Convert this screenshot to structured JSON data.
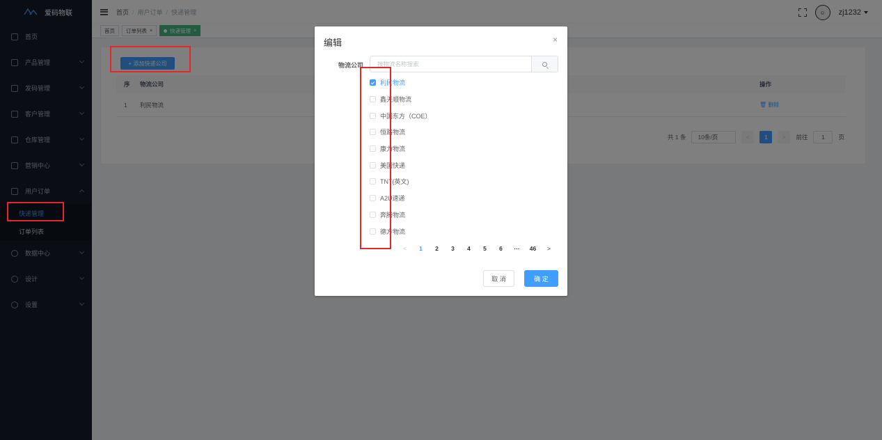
{
  "app": {
    "name": "爱码物联"
  },
  "sidebar": {
    "items": [
      {
        "label": "首页"
      },
      {
        "label": "产品管理"
      },
      {
        "label": "发码管理"
      },
      {
        "label": "客户管理"
      },
      {
        "label": "仓库管理"
      },
      {
        "label": "营销中心"
      },
      {
        "label": "用户订单"
      },
      {
        "label": "数据中心"
      },
      {
        "label": "设计"
      },
      {
        "label": "设置"
      }
    ],
    "submenu": [
      {
        "label": "快递管理"
      },
      {
        "label": "订单列表"
      }
    ]
  },
  "topbar": {
    "breadcrumb": [
      "首页",
      "用户订单",
      "快递管理"
    ],
    "sep": "/",
    "user": "zj1232"
  },
  "tags": [
    {
      "label": "首页"
    },
    {
      "label": "订单列表"
    },
    {
      "label": "快递管理"
    }
  ],
  "tag_close": "×",
  "main": {
    "add_button": "+ 添加快递公司",
    "table": {
      "headers": [
        "序",
        "物流公司",
        "操作"
      ],
      "rows": [
        {
          "index": "1",
          "company": "利民物流",
          "action": "删除"
        }
      ]
    },
    "pager": {
      "total": "共 1 条",
      "size": "10条/页",
      "current": "1",
      "goto": "前往",
      "goto_value": "1",
      "page_unit": "页",
      "prev": "<",
      "next": ">"
    }
  },
  "dialog": {
    "title": "编辑",
    "close": "×",
    "field_label": "物流公司",
    "search_placeholder": "按物流名称搜索",
    "options": [
      {
        "label": "利民物流",
        "checked": true
      },
      {
        "label": "鑫天顺物流",
        "checked": false
      },
      {
        "label": "中国东方（COE）",
        "checked": false
      },
      {
        "label": "恒路物流",
        "checked": false
      },
      {
        "label": "康力物流",
        "checked": false
      },
      {
        "label": "美国快递",
        "checked": false
      },
      {
        "label": "TNT(英文)",
        "checked": false
      },
      {
        "label": "A2U速递",
        "checked": false
      },
      {
        "label": "奔腾物流",
        "checked": false
      },
      {
        "label": "德方物流",
        "checked": false
      }
    ],
    "pager": {
      "prev": "<",
      "pages": [
        "1",
        "2",
        "3",
        "4",
        "5",
        "6",
        "···",
        "46"
      ],
      "next": ">",
      "current": "1"
    },
    "cancel": "取 消",
    "confirm": "确 定"
  },
  "colors": {
    "primary": "#409eff",
    "sidebar": "#151b29",
    "tag_active": "#42b983",
    "highlight": "#e5262b"
  }
}
